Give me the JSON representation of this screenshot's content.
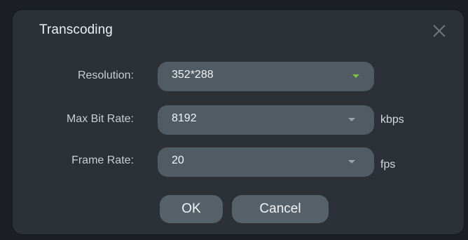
{
  "dialog": {
    "title": "Transcoding",
    "close_icon": "close-icon"
  },
  "fields": {
    "resolution": {
      "label": "Resolution:",
      "value": "352*288",
      "unit": ""
    },
    "max_bit_rate": {
      "label": "Max Bit Rate:",
      "value": "8192",
      "unit": "kbps"
    },
    "frame_rate": {
      "label": "Frame Rate:",
      "value": "20",
      "unit": "fps"
    }
  },
  "buttons": {
    "ok": "OK",
    "cancel": "Cancel"
  },
  "colors": {
    "dialog_bg": "#2b3136",
    "field_bg": "#515b63",
    "button_bg": "#56616a",
    "active_arrow": "#7ec242"
  }
}
